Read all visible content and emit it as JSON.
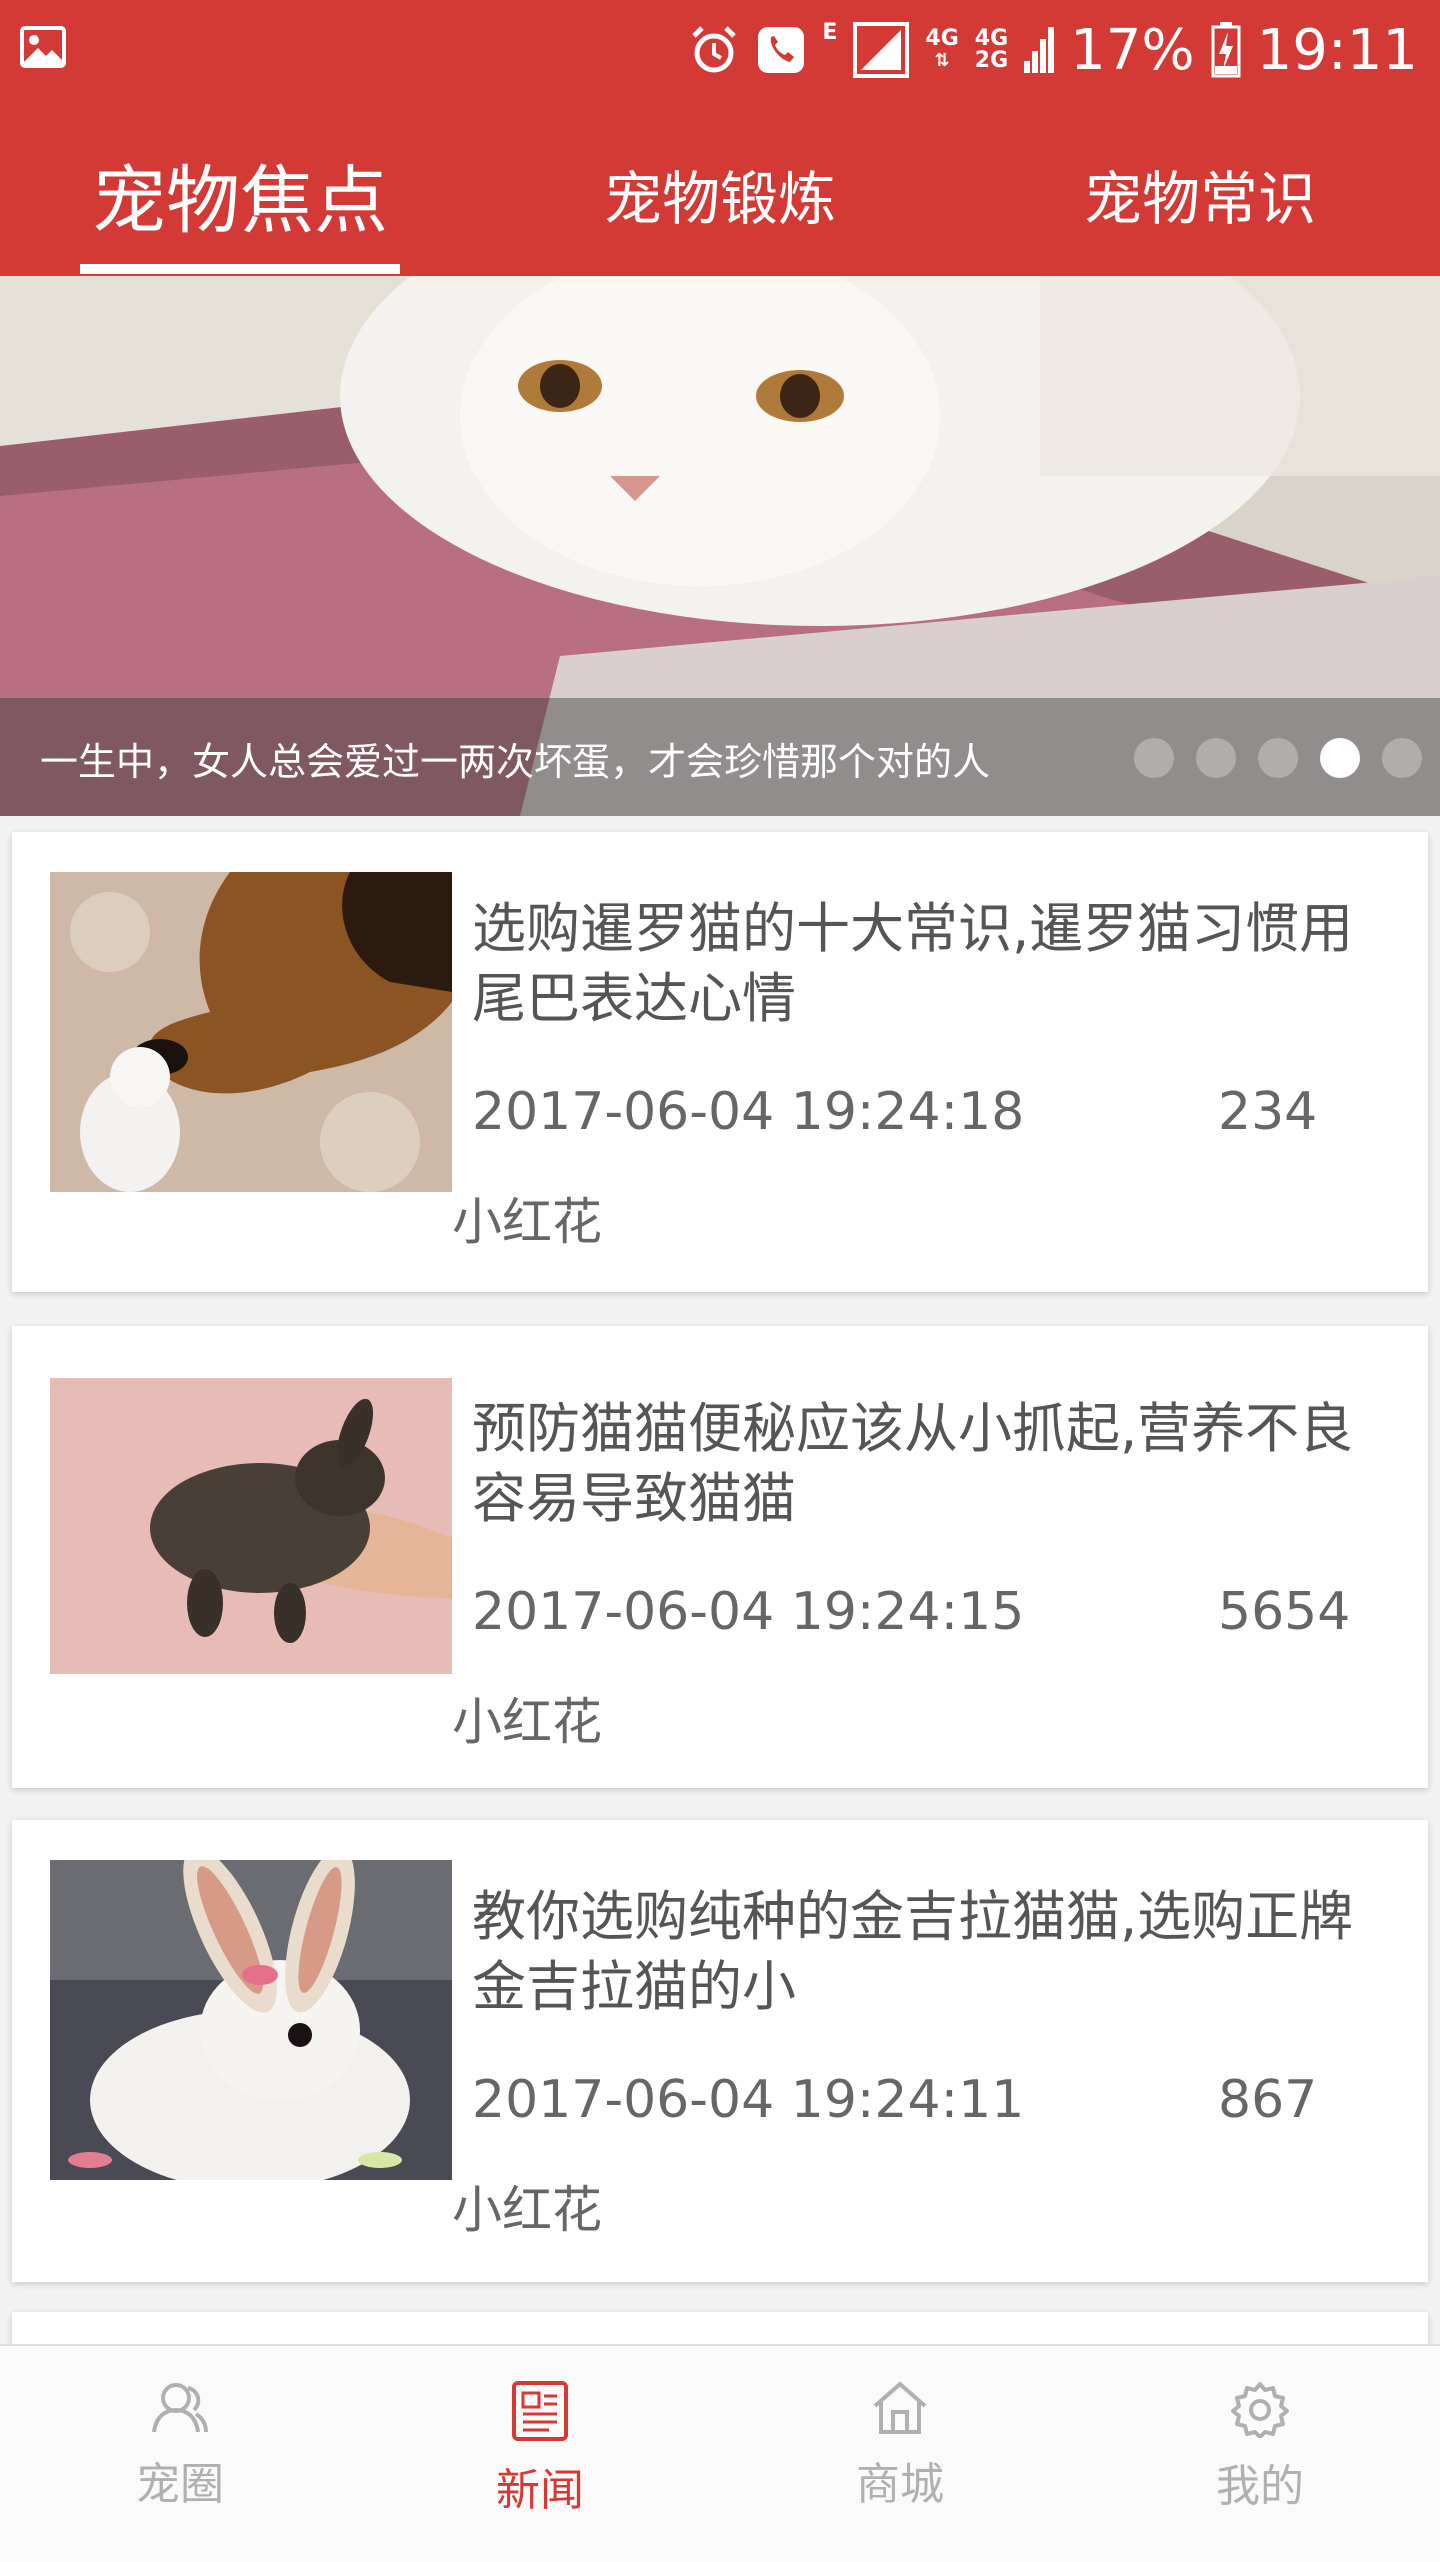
{
  "status_bar": {
    "network_e": "E",
    "network_4g": "4G",
    "network_4g2g_top": "4G",
    "network_4g2g_bottom": "2G",
    "battery": "17%",
    "time": "19:11"
  },
  "tabs": [
    {
      "label": "宠物焦点",
      "active": true
    },
    {
      "label": "宠物锻炼",
      "active": false
    },
    {
      "label": "宠物常识",
      "active": false
    }
  ],
  "banner": {
    "caption": "一生中，女人总会爱过一两次坏蛋，才会珍惜那个对的人",
    "active_dot": 4,
    "dot_count": 5
  },
  "news": [
    {
      "title": "选购暹罗猫的十大常识,暹罗猫习惯用尾巴表达心情",
      "date": "2017-06-04 19:24:18",
      "count": "234",
      "author": "小红花",
      "thumb_icon": "dog-and-kitten-image"
    },
    {
      "title": "预防猫猫便秘应该从小抓起,营养不良容易导致猫猫",
      "date": "2017-06-04 19:24:15",
      "count": "5654",
      "author": "小红花",
      "thumb_icon": "rabbit-in-hand-image"
    },
    {
      "title": "教你选购纯种的金吉拉猫猫,选购正牌金吉拉猫的小",
      "date": "2017-06-04 19:24:11",
      "count": "867",
      "author": "小红花",
      "thumb_icon": "white-rabbit-image"
    }
  ],
  "bottom_nav": [
    {
      "label": "宠圈",
      "icon": "person-icon",
      "active": false
    },
    {
      "label": "新闻",
      "icon": "news-icon",
      "active": true
    },
    {
      "label": "商城",
      "icon": "home-icon",
      "active": false
    },
    {
      "label": "我的",
      "icon": "gear-icon",
      "active": false
    }
  ],
  "colors": {
    "brand": "#d43a35",
    "inactive_nav": "#b0b0b0"
  }
}
